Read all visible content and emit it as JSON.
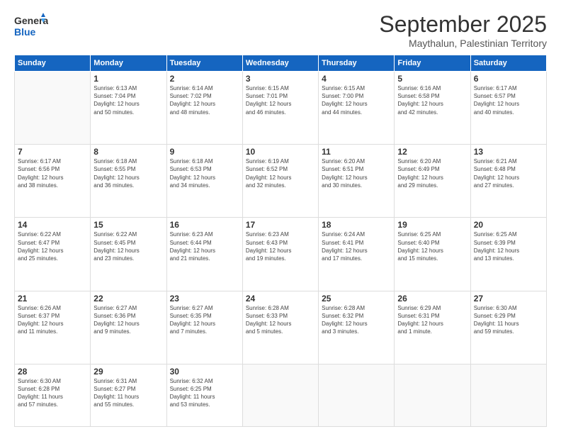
{
  "header": {
    "logo_line1": "General",
    "logo_line2": "Blue",
    "month": "September 2025",
    "location": "Maythalun, Palestinian Territory"
  },
  "days_of_week": [
    "Sunday",
    "Monday",
    "Tuesday",
    "Wednesday",
    "Thursday",
    "Friday",
    "Saturday"
  ],
  "weeks": [
    [
      {
        "day": "",
        "info": ""
      },
      {
        "day": "1",
        "info": "Sunrise: 6:13 AM\nSunset: 7:04 PM\nDaylight: 12 hours\nand 50 minutes."
      },
      {
        "day": "2",
        "info": "Sunrise: 6:14 AM\nSunset: 7:02 PM\nDaylight: 12 hours\nand 48 minutes."
      },
      {
        "day": "3",
        "info": "Sunrise: 6:15 AM\nSunset: 7:01 PM\nDaylight: 12 hours\nand 46 minutes."
      },
      {
        "day": "4",
        "info": "Sunrise: 6:15 AM\nSunset: 7:00 PM\nDaylight: 12 hours\nand 44 minutes."
      },
      {
        "day": "5",
        "info": "Sunrise: 6:16 AM\nSunset: 6:58 PM\nDaylight: 12 hours\nand 42 minutes."
      },
      {
        "day": "6",
        "info": "Sunrise: 6:17 AM\nSunset: 6:57 PM\nDaylight: 12 hours\nand 40 minutes."
      }
    ],
    [
      {
        "day": "7",
        "info": "Sunrise: 6:17 AM\nSunset: 6:56 PM\nDaylight: 12 hours\nand 38 minutes."
      },
      {
        "day": "8",
        "info": "Sunrise: 6:18 AM\nSunset: 6:55 PM\nDaylight: 12 hours\nand 36 minutes."
      },
      {
        "day": "9",
        "info": "Sunrise: 6:18 AM\nSunset: 6:53 PM\nDaylight: 12 hours\nand 34 minutes."
      },
      {
        "day": "10",
        "info": "Sunrise: 6:19 AM\nSunset: 6:52 PM\nDaylight: 12 hours\nand 32 minutes."
      },
      {
        "day": "11",
        "info": "Sunrise: 6:20 AM\nSunset: 6:51 PM\nDaylight: 12 hours\nand 30 minutes."
      },
      {
        "day": "12",
        "info": "Sunrise: 6:20 AM\nSunset: 6:49 PM\nDaylight: 12 hours\nand 29 minutes."
      },
      {
        "day": "13",
        "info": "Sunrise: 6:21 AM\nSunset: 6:48 PM\nDaylight: 12 hours\nand 27 minutes."
      }
    ],
    [
      {
        "day": "14",
        "info": "Sunrise: 6:22 AM\nSunset: 6:47 PM\nDaylight: 12 hours\nand 25 minutes."
      },
      {
        "day": "15",
        "info": "Sunrise: 6:22 AM\nSunset: 6:45 PM\nDaylight: 12 hours\nand 23 minutes."
      },
      {
        "day": "16",
        "info": "Sunrise: 6:23 AM\nSunset: 6:44 PM\nDaylight: 12 hours\nand 21 minutes."
      },
      {
        "day": "17",
        "info": "Sunrise: 6:23 AM\nSunset: 6:43 PM\nDaylight: 12 hours\nand 19 minutes."
      },
      {
        "day": "18",
        "info": "Sunrise: 6:24 AM\nSunset: 6:41 PM\nDaylight: 12 hours\nand 17 minutes."
      },
      {
        "day": "19",
        "info": "Sunrise: 6:25 AM\nSunset: 6:40 PM\nDaylight: 12 hours\nand 15 minutes."
      },
      {
        "day": "20",
        "info": "Sunrise: 6:25 AM\nSunset: 6:39 PM\nDaylight: 12 hours\nand 13 minutes."
      }
    ],
    [
      {
        "day": "21",
        "info": "Sunrise: 6:26 AM\nSunset: 6:37 PM\nDaylight: 12 hours\nand 11 minutes."
      },
      {
        "day": "22",
        "info": "Sunrise: 6:27 AM\nSunset: 6:36 PM\nDaylight: 12 hours\nand 9 minutes."
      },
      {
        "day": "23",
        "info": "Sunrise: 6:27 AM\nSunset: 6:35 PM\nDaylight: 12 hours\nand 7 minutes."
      },
      {
        "day": "24",
        "info": "Sunrise: 6:28 AM\nSunset: 6:33 PM\nDaylight: 12 hours\nand 5 minutes."
      },
      {
        "day": "25",
        "info": "Sunrise: 6:28 AM\nSunset: 6:32 PM\nDaylight: 12 hours\nand 3 minutes."
      },
      {
        "day": "26",
        "info": "Sunrise: 6:29 AM\nSunset: 6:31 PM\nDaylight: 12 hours\nand 1 minute."
      },
      {
        "day": "27",
        "info": "Sunrise: 6:30 AM\nSunset: 6:29 PM\nDaylight: 11 hours\nand 59 minutes."
      }
    ],
    [
      {
        "day": "28",
        "info": "Sunrise: 6:30 AM\nSunset: 6:28 PM\nDaylight: 11 hours\nand 57 minutes."
      },
      {
        "day": "29",
        "info": "Sunrise: 6:31 AM\nSunset: 6:27 PM\nDaylight: 11 hours\nand 55 minutes."
      },
      {
        "day": "30",
        "info": "Sunrise: 6:32 AM\nSunset: 6:25 PM\nDaylight: 11 hours\nand 53 minutes."
      },
      {
        "day": "",
        "info": ""
      },
      {
        "day": "",
        "info": ""
      },
      {
        "day": "",
        "info": ""
      },
      {
        "day": "",
        "info": ""
      }
    ]
  ]
}
